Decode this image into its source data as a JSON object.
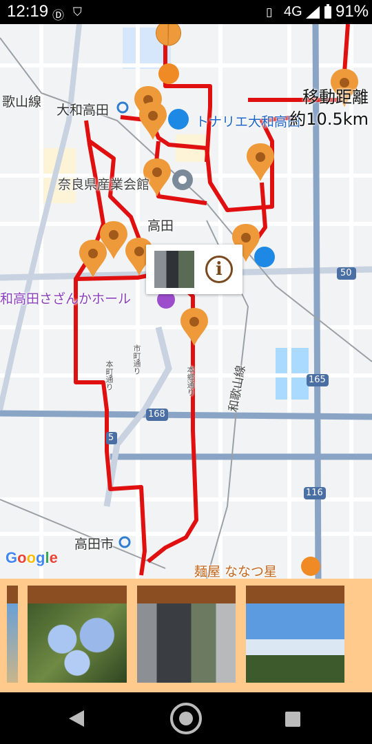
{
  "status_bar": {
    "time": "12:19",
    "network": "4G",
    "battery": "91%"
  },
  "map": {
    "labels": {
      "wakayama_line_left": "歌山線",
      "yamato_takada": "大和高田",
      "tonarie": "トナリエ大和高田",
      "nara_sangyo": "奈良県産業会館",
      "takada": "高田",
      "sazanka_hall": "和高田さざんかホール",
      "takadashi": "高田市",
      "menya_natsuboshi": "麺屋 ななつ星",
      "wakayama_line_vertical": "和歌山線",
      "ichimachi_dori": "市町通り",
      "honmachi_dori_1": "本町通り",
      "honmachi_dori_2": "本郷通り",
      "route_168": "168",
      "route_165": "165",
      "route_116": "116",
      "route_50": "50",
      "route_5": "5"
    },
    "stats": {
      "distance_label": "移動距離",
      "distance_value": "約10.5km"
    },
    "popup": {
      "info_icon": "info-icon",
      "info_glyph": "i"
    },
    "logo": "Google",
    "route_color": "#e01010",
    "marker_color": "#ee9a3a"
  },
  "photo_strip": {
    "photos": [
      "blue flowers",
      "stone monument",
      "sky and trees"
    ]
  }
}
